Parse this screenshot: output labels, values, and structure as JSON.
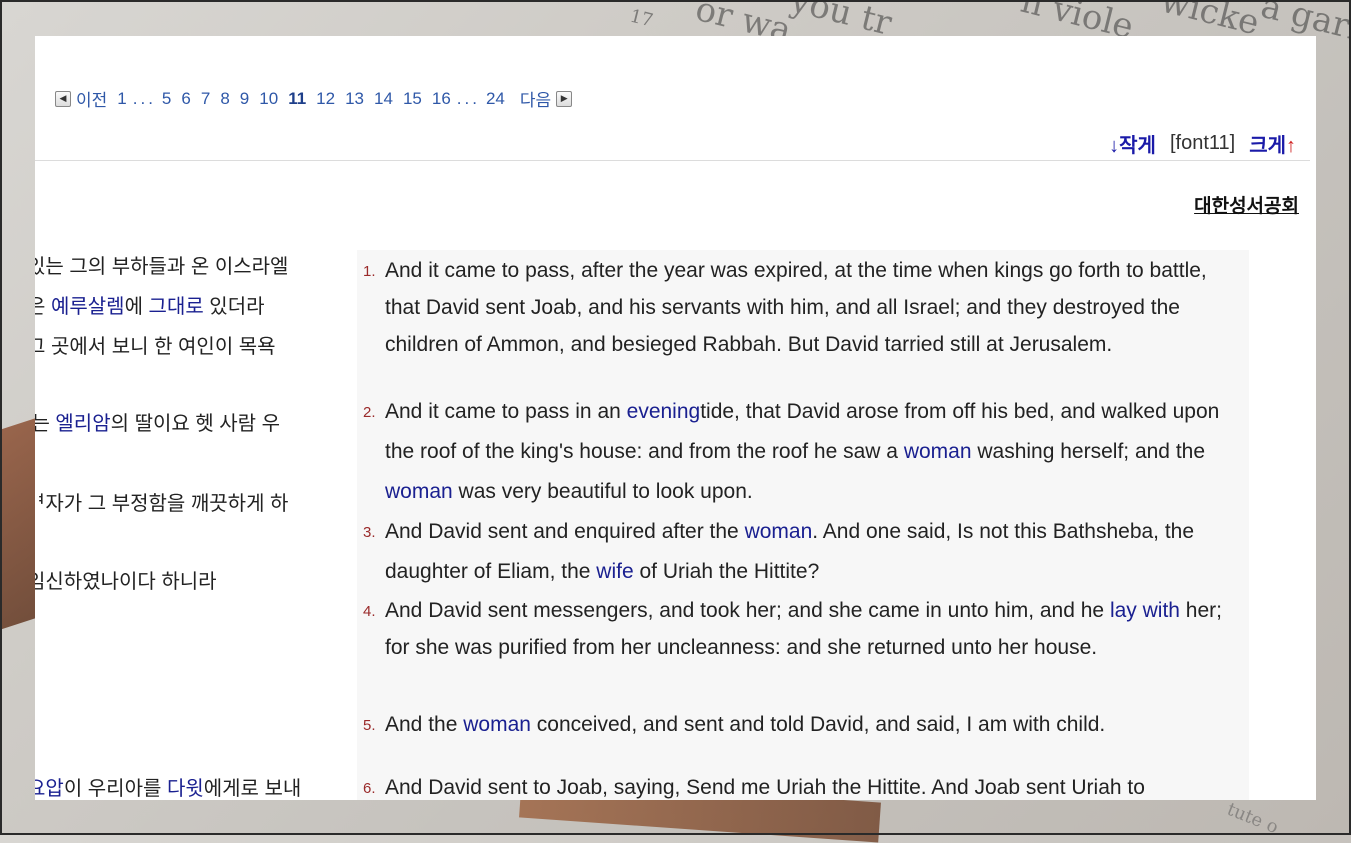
{
  "background": {
    "texts": [
      "17",
      "or wa",
      "you tr",
      "n viole",
      "wicke",
      "a garm"
    ],
    "bottom_note": "tute o"
  },
  "pager": {
    "prev": "이전",
    "pages": [
      "1",
      "...",
      "5",
      "6",
      "7",
      "8",
      "9",
      "10",
      "11",
      "12",
      "13",
      "14",
      "15",
      "16",
      "...",
      "24"
    ],
    "current": "11",
    "next": "다음"
  },
  "fontbar": {
    "smaller_label": "작게",
    "smaller_arrow": "↓",
    "font_label": "[font11]",
    "larger_label": "크게",
    "larger_arrow": "↑"
  },
  "publisher": "대한성서공회",
  "korean_lines": [
    {
      "parts": [
        {
          "t": "있는 그의 부하들과 온 이스라엘",
          "h": false
        }
      ]
    },
    {
      "parts": [
        {
          "t": "은 ",
          "h": false
        },
        {
          "t": "예루살렘",
          "h": true
        },
        {
          "t": "에 ",
          "h": false
        },
        {
          "t": "그대로",
          "h": true
        },
        {
          "t": " 있더라",
          "h": false
        }
      ]
    },
    {
      "parts": [
        {
          "t": " 그 곳에서 보니 한 여인이 목욕",
          "h": false
        }
      ]
    },
    {
      "parts": [
        {
          "t": "l는 ",
          "h": false
        },
        {
          "t": "엘리암",
          "h": true
        },
        {
          "t": "의 딸이요 헷 사람 우",
          "h": false
        }
      ]
    },
    {
      "parts": [
        {
          "t": "ᅧ자가 그 부정함을 깨끗하게 하",
          "h": false
        }
      ]
    },
    {
      "parts": [
        {
          "t": "임신하였나이다 하니라",
          "h": false
        }
      ]
    },
    {
      "parts": [
        {
          "t": "요압",
          "h": true
        },
        {
          "t": "이 우리아를 ",
          "h": false
        },
        {
          "t": "다윗",
          "h": true
        },
        {
          "t": "에게로 보내",
          "h": false
        }
      ]
    }
  ],
  "verses": [
    {
      "num": "1.",
      "parts": [
        {
          "t": "And it came to pass, after the year was expired, at the time when kings go forth to battle, that David sent Joab, and his servants with him, and all Israel; and they destroyed the children of Ammon, and besieged Rabbah. But David tarried still at Jerusalem.",
          "h": false
        }
      ]
    },
    {
      "num": "2.",
      "parts": [
        {
          "t": "And it came to pass in an ",
          "h": false
        },
        {
          "t": "evening",
          "h": true
        },
        {
          "t": "tide, that David arose from off his bed, and walked upon the roof of the king's house: and from the roof he saw a ",
          "h": false
        },
        {
          "t": "woman",
          "h": true
        },
        {
          "t": " washing herself; and the ",
          "h": false
        },
        {
          "t": "woman",
          "h": true
        },
        {
          "t": " was very beautiful to look upon.",
          "h": false
        }
      ]
    },
    {
      "num": "3.",
      "parts": [
        {
          "t": "And David sent and enquired after the ",
          "h": false
        },
        {
          "t": "woman",
          "h": true
        },
        {
          "t": ". And one said, Is not this Bathsheba, the daughter of Eliam, the ",
          "h": false
        },
        {
          "t": "wife",
          "h": true
        },
        {
          "t": " of Uriah the Hittite?",
          "h": false
        }
      ]
    },
    {
      "num": "4.",
      "parts": [
        {
          "t": "And David sent messengers, and took her; and she came in unto him, and he ",
          "h": false
        },
        {
          "t": "lay with",
          "h": true
        },
        {
          "t": " her; for she was purified from her uncleanness: and she returned unto her house.",
          "h": false
        }
      ]
    },
    {
      "num": "5.",
      "parts": [
        {
          "t": "And the ",
          "h": false
        },
        {
          "t": "woman",
          "h": true
        },
        {
          "t": " conceived, and sent and told David, and said, I am with child.",
          "h": false
        }
      ]
    },
    {
      "num": "6.",
      "parts": [
        {
          "t": "And David sent to Joab, saying, Send me Uriah the Hittite. And Joab sent Uriah to",
          "h": false
        }
      ]
    }
  ],
  "colors": {
    "link": "#2f58a8",
    "highlight": "#1a2090",
    "verse_number": "#9a2a2a",
    "font_up": "#d02020"
  }
}
